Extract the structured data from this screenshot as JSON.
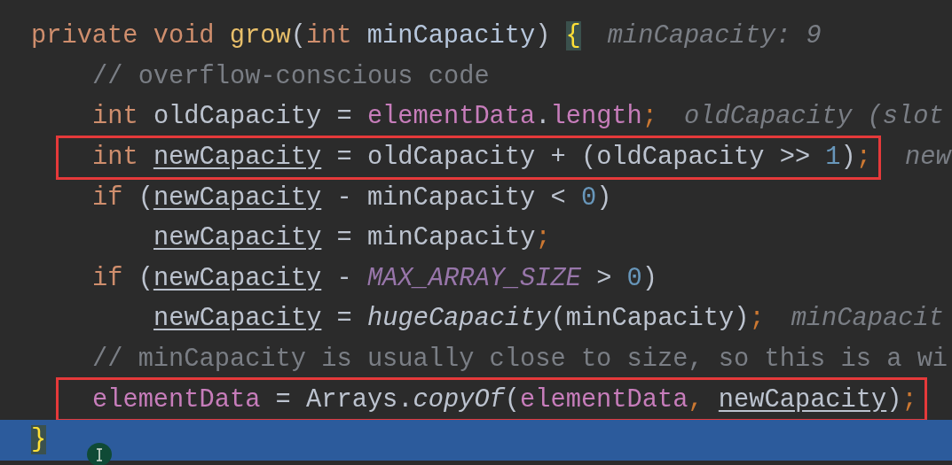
{
  "editor": {
    "lines": [
      {
        "kind": "top",
        "boxed": false,
        "selected": false,
        "tokens": [
          {
            "text": "private void ",
            "kind": "keyword"
          },
          {
            "text": "grow",
            "kind": "method"
          },
          {
            "text": "(",
            "kind": "plain"
          },
          {
            "text": "int ",
            "kind": "keyword"
          },
          {
            "text": "minCapacity",
            "kind": "param"
          },
          {
            "text": ") ",
            "kind": "plain"
          },
          {
            "text": "{",
            "kind": "brace-match"
          }
        ],
        "hint": "minCapacity: 9"
      },
      {
        "kind": "body",
        "boxed": false,
        "selected": false,
        "tokens": [
          {
            "text": "// overflow-conscious code",
            "kind": "comment"
          }
        ]
      },
      {
        "kind": "body",
        "boxed": false,
        "selected": false,
        "tokens": [
          {
            "text": "int ",
            "kind": "keyword"
          },
          {
            "text": "oldCapacity = ",
            "kind": "plain"
          },
          {
            "text": "elementData",
            "kind": "field"
          },
          {
            "text": ".",
            "kind": "plain"
          },
          {
            "text": "length",
            "kind": "field"
          },
          {
            "text": ";",
            "kind": "semi"
          }
        ],
        "hint": "oldCapacity (slot"
      },
      {
        "kind": "body",
        "boxed": true,
        "selected": false,
        "tokens": [
          {
            "text": "int ",
            "kind": "keyword"
          },
          {
            "text": "newCapacity",
            "kind": "reassigned"
          },
          {
            "text": " = oldCapacity + (oldCapacity >> ",
            "kind": "plain"
          },
          {
            "text": "1",
            "kind": "number"
          },
          {
            "text": ")",
            "kind": "plain"
          },
          {
            "text": ";",
            "kind": "semi"
          }
        ],
        "hint": "new"
      },
      {
        "kind": "body",
        "boxed": false,
        "selected": false,
        "tokens": [
          {
            "text": "if ",
            "kind": "keyword"
          },
          {
            "text": "(",
            "kind": "plain"
          },
          {
            "text": "newCapacity",
            "kind": "reassigned"
          },
          {
            "text": " - minCapacity < ",
            "kind": "plain"
          },
          {
            "text": "0",
            "kind": "number"
          },
          {
            "text": ")",
            "kind": "plain"
          }
        ]
      },
      {
        "kind": "nested",
        "boxed": false,
        "selected": false,
        "tokens": [
          {
            "text": "newCapacity",
            "kind": "reassigned"
          },
          {
            "text": " = minCapacity",
            "kind": "plain"
          },
          {
            "text": ";",
            "kind": "semi"
          }
        ]
      },
      {
        "kind": "body",
        "boxed": false,
        "selected": false,
        "tokens": [
          {
            "text": "if ",
            "kind": "keyword"
          },
          {
            "text": "(",
            "kind": "plain"
          },
          {
            "text": "newCapacity",
            "kind": "reassigned"
          },
          {
            "text": " - ",
            "kind": "plain"
          },
          {
            "text": "MAX_ARRAY_SIZE",
            "kind": "constant"
          },
          {
            "text": " > ",
            "kind": "plain"
          },
          {
            "text": "0",
            "kind": "number"
          },
          {
            "text": ")",
            "kind": "plain"
          }
        ]
      },
      {
        "kind": "nested",
        "boxed": false,
        "selected": false,
        "tokens": [
          {
            "text": "newCapacity",
            "kind": "reassigned"
          },
          {
            "text": " = ",
            "kind": "plain"
          },
          {
            "text": "hugeCapacity",
            "kind": "static-call"
          },
          {
            "text": "(minCapacity)",
            "kind": "plain"
          },
          {
            "text": ";",
            "kind": "semi"
          }
        ],
        "hint": "minCapacit"
      },
      {
        "kind": "body",
        "boxed": false,
        "selected": false,
        "tokens": [
          {
            "text": "// minCapacity is usually close to size, so this is a wi",
            "kind": "comment"
          }
        ]
      },
      {
        "kind": "body",
        "boxed": true,
        "selected": false,
        "tokens": [
          {
            "text": "elementData",
            "kind": "field"
          },
          {
            "text": " = Arrays.",
            "kind": "plain"
          },
          {
            "text": "copyOf",
            "kind": "static-call"
          },
          {
            "text": "(",
            "kind": "plain"
          },
          {
            "text": "elementData",
            "kind": "field"
          },
          {
            "text": ", ",
            "kind": "semi"
          },
          {
            "text": "newCapacity",
            "kind": "reassigned"
          },
          {
            "text": ")",
            "kind": "plain"
          },
          {
            "text": ";",
            "kind": "semi"
          }
        ]
      },
      {
        "kind": "top",
        "boxed": false,
        "selected": true,
        "tokens": [
          {
            "text": "}",
            "kind": "brace-match"
          }
        ]
      }
    ]
  }
}
